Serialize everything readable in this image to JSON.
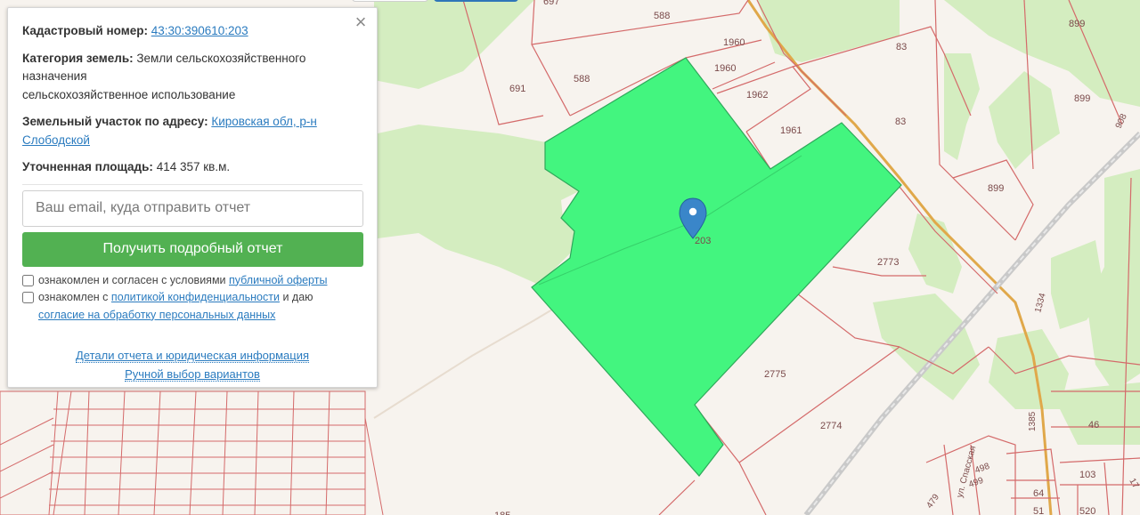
{
  "panel": {
    "close_glyph": "×",
    "cadastral_label": "Кадастровый номер:",
    "cadastral_value": "43:30:390610:203",
    "category_label": "Категория земель:",
    "category_value": "Земли сельскохозяйственного назначения",
    "usage_value": "сельскохозяйственное использование",
    "address_label": "Земельный участок по адресу:",
    "address_value": "Кировская обл, р-н Слободской",
    "area_label": "Уточненная площадь:",
    "area_value": "414 357 кв.м.",
    "email_placeholder": "Ваш email, куда отправить отчет",
    "report_button": "Получить подробный отчет",
    "consent1_text": "ознакомлен и согласен с условиями",
    "consent1_link": "публичной оферты",
    "consent2_text_a": "ознакомлен с",
    "consent2_link_a": "политикой конфиденциальности",
    "consent2_text_b": "и даю",
    "consent2_link_b": "согласие на обработку персональных данных",
    "details_link": "Детали отчета и юридическая информация",
    "manual_link": "Ручной выбор вариантов"
  },
  "map": {
    "selected_plot_color": "#43f57f",
    "selected_plot_label": "203",
    "marker_icon": "map-pin-icon",
    "plot_labels": [
      "691",
      "588",
      "588",
      "1960",
      "1960",
      "1962",
      "1961",
      "83",
      "83",
      "899",
      "899",
      "899",
      "908",
      "2773",
      "2775",
      "2774",
      "1334",
      "1385",
      "46",
      "498",
      "499",
      "479",
      "64",
      "51",
      "103",
      "520",
      "185",
      "17",
      "697",
      "ул. Спасская"
    ]
  }
}
